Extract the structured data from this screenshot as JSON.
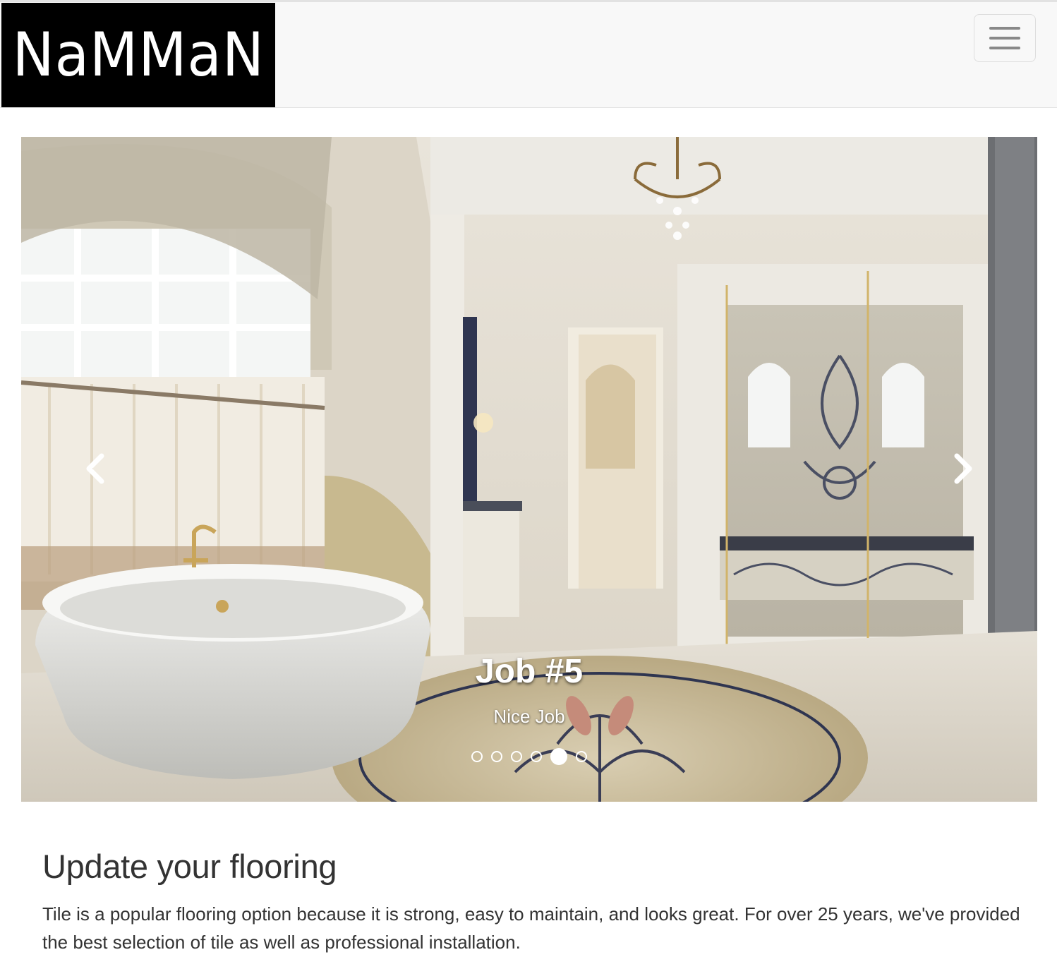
{
  "navbar": {
    "brand": "NaMMaN",
    "toggle_icon": "hamburger-menu-icon"
  },
  "carousel": {
    "slide_title": "Job #5",
    "slide_caption": "Nice Job",
    "prev_icon": "chevron-left-icon",
    "next_icon": "chevron-right-icon",
    "indicator_count": 6,
    "active_indicator": 5
  },
  "content": {
    "heading": "Update your flooring",
    "paragraph": "Tile is a popular flooring option because it is strong, easy to maintain, and looks great. For over 25 years, we've provided the best selection of tile as well as professional installation."
  }
}
